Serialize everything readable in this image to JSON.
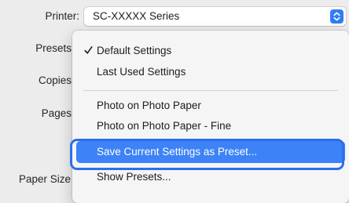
{
  "form": {
    "printer_label": "Printer:",
    "printer_value": "SC-XXXXX Series",
    "presets_label": "Presets",
    "copies_label": "Copies",
    "pages_label": "Pages",
    "paper_size_label": "Paper Size"
  },
  "presets_menu": {
    "items": [
      {
        "label": "Default Settings",
        "checked": true
      },
      {
        "label": "Last Used Settings"
      },
      {
        "label": "Photo on Photo Paper"
      },
      {
        "label": "Photo on Photo Paper - Fine"
      },
      {
        "label": "Save Current Settings as Preset...",
        "highlighted": true
      },
      {
        "label": "Show Presets..."
      }
    ]
  },
  "icons": {
    "checkmark": "checkmark-icon",
    "dropdown": "chevron-updown-icon"
  },
  "colors": {
    "background": "#ececec",
    "accent": "#3d82f6",
    "highlight_ring": "#2a6ef2",
    "menu_bg": "#f5f5f5"
  }
}
